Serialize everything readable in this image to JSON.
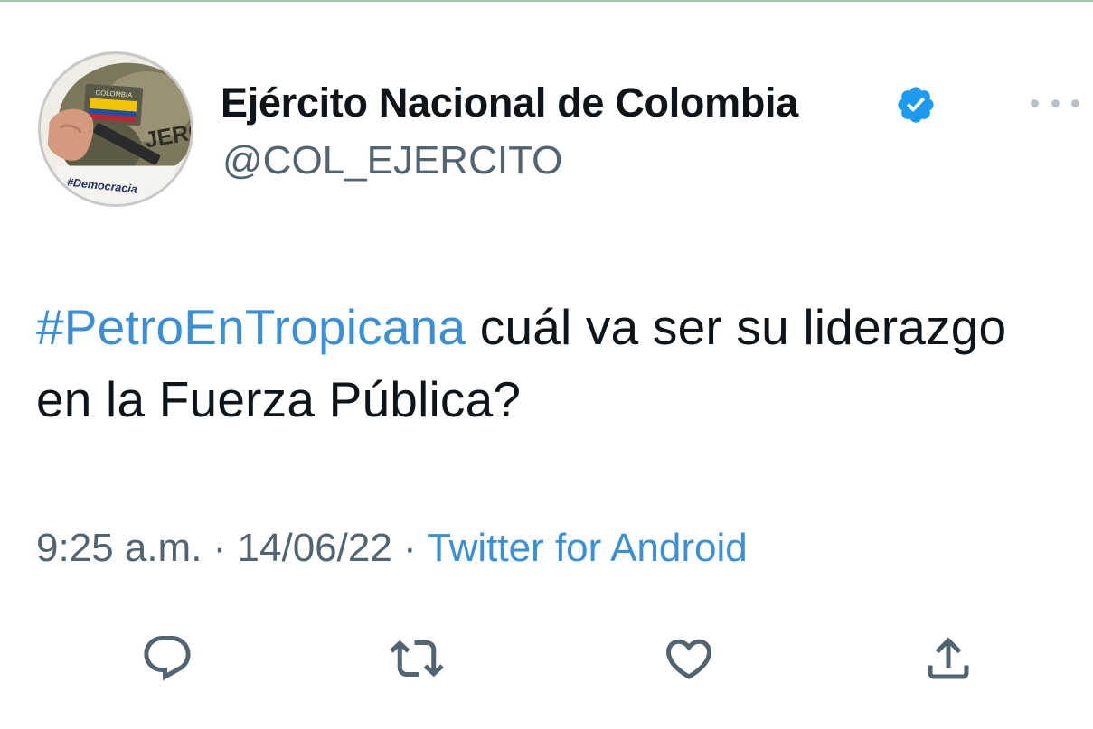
{
  "tweet": {
    "author_name": "Ejército Nacional de Colombia",
    "handle": "@COL_EJERCITO",
    "verified": true,
    "hashtag": "#PetroEnTropicana",
    "text_rest": " cuál va ser su liderazgo en la Fuerza Pública?",
    "time": "9:25 a.m.",
    "separator": " · ",
    "date": "14/06/22",
    "source": "Twitter for Android"
  },
  "avatar": {
    "patch_text": "COLOMBIA",
    "badge_text": "#Democracia",
    "uniform_text": "JERCIT"
  },
  "actions": [
    {
      "name": "reply-icon"
    },
    {
      "name": "retweet-icon"
    },
    {
      "name": "like-icon"
    },
    {
      "name": "share-icon"
    }
  ],
  "colors": {
    "text": "#0f1419",
    "secondary": "#536471",
    "link": "#3a8fd6",
    "verified": "#1d9bf0"
  }
}
